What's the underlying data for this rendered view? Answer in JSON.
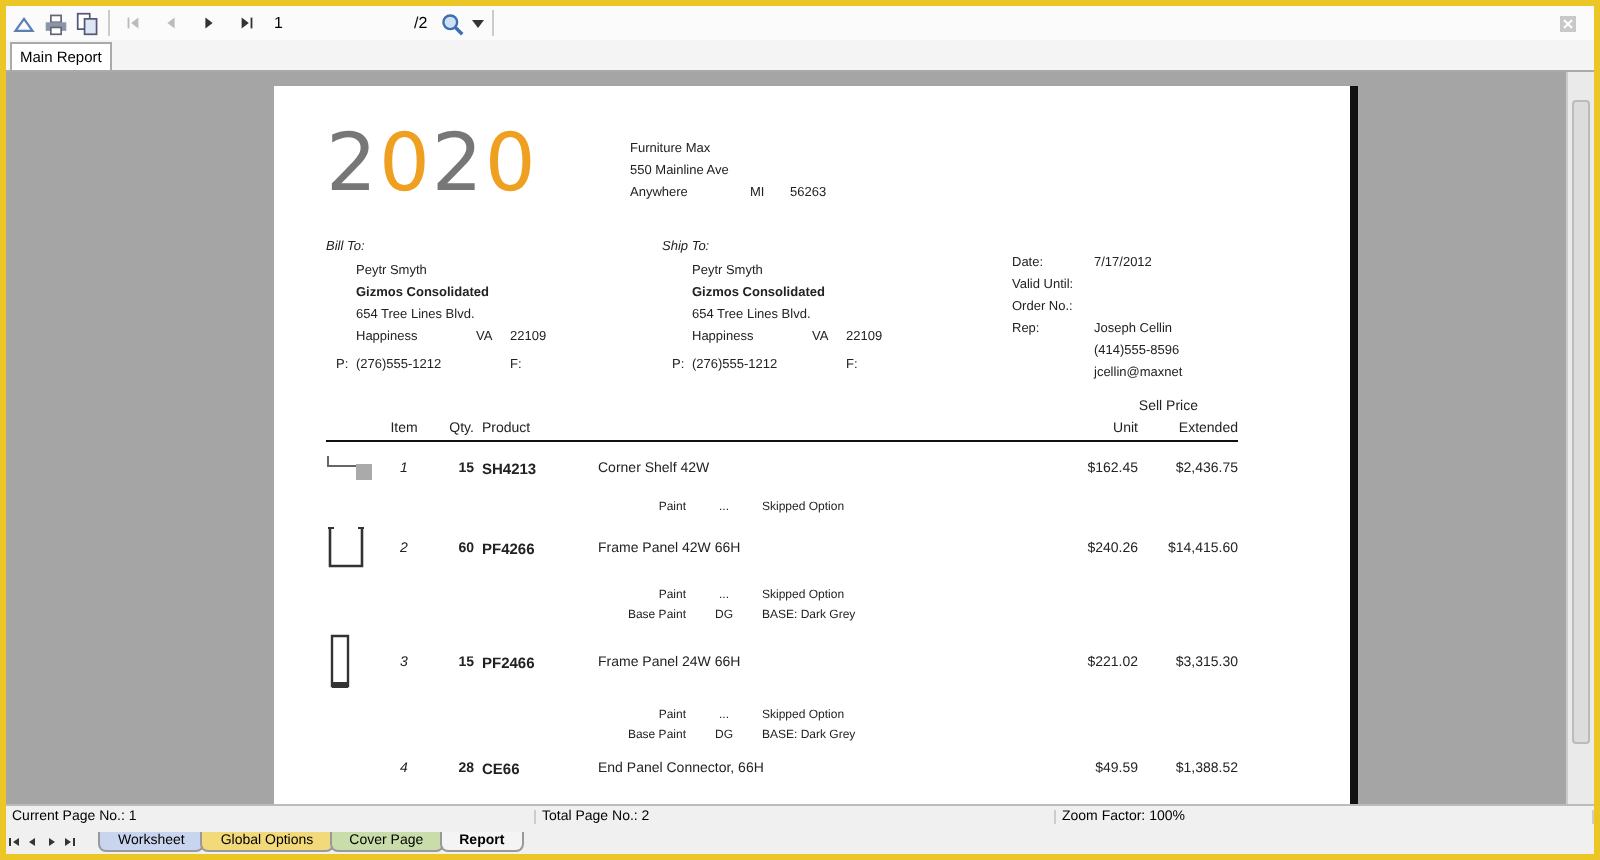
{
  "toolbar": {
    "page_input": "1",
    "page_total": "/2"
  },
  "tabs": [
    {
      "label": "Main Report",
      "selected": true
    }
  ],
  "report": {
    "logo": "2020",
    "company": {
      "name": "Furniture Max",
      "street": "550 Mainline Ave",
      "city": "Anywhere",
      "state": "MI",
      "zip": "56263"
    },
    "addresses": [
      {
        "heading": "Bill To:",
        "name": "Peytr Smyth",
        "company": "Gizmos Consolidated",
        "street": "654 Tree Lines Blvd.",
        "city": "Happiness",
        "state": "VA",
        "zip": "22109",
        "phone_label": "P:",
        "phone": "(276)555-1212",
        "fax_label": "F:"
      },
      {
        "heading": "Ship To:",
        "name": "Peytr Smyth",
        "company": "Gizmos Consolidated",
        "street": "654 Tree Lines Blvd.",
        "city": "Happiness",
        "state": "VA",
        "zip": "22109",
        "phone_label": "P:",
        "phone": "(276)555-1212",
        "fax_label": "F:"
      }
    ],
    "order_info": [
      {
        "label": "Date:",
        "value": "7/17/2012"
      },
      {
        "label": "Valid Until:"
      },
      {
        "label": "Order No.:"
      },
      {
        "label": "Rep:",
        "value": "Joseph Cellin"
      },
      {
        "value": "(414)555-8596"
      },
      {
        "value": "jcellin@maxnet"
      }
    ],
    "price_group": "Sell Price",
    "columns": [
      "Item",
      "Qty.",
      "Product",
      "Unit",
      "Extended"
    ],
    "rows": [
      {
        "kind": "shelf",
        "item": "1",
        "qty": "15",
        "code": "SH4213",
        "description": "Corner Shelf 42W",
        "unit": "$162.45",
        "extended": "$2,436.75",
        "options": [
          {
            "name": "Paint",
            "code": "...",
            "description": "Skipped Option"
          }
        ]
      },
      {
        "kind": "wide-panel",
        "item": "2",
        "qty": "60",
        "code": "PF4266",
        "description": "Frame Panel 42W 66H",
        "unit": "$240.26",
        "extended": "$14,415.60",
        "options": [
          {
            "name": "Paint",
            "code": "...",
            "description": "Skipped Option"
          },
          {
            "name": "Base Paint",
            "code": "DG",
            "description": "BASE: Dark Grey"
          }
        ]
      },
      {
        "kind": "narrow-panel",
        "item": "3",
        "qty": "15",
        "code": "PF2466",
        "description": "Frame Panel 24W 66H",
        "unit": "$221.02",
        "extended": "$3,315.30",
        "options": [
          {
            "name": "Paint",
            "code": "...",
            "description": "Skipped Option"
          },
          {
            "name": "Base Paint",
            "code": "DG",
            "description": "BASE: Dark Grey"
          }
        ]
      },
      {
        "kind": "plain",
        "item": "4",
        "qty": "28",
        "code": "CE66",
        "description": "End Panel Connector, 66H",
        "unit": "$49.59",
        "extended": "$1,388.52",
        "options": []
      }
    ]
  },
  "status_bar": [
    "Current Page No.: 1",
    "Total Page No.: 2",
    "Zoom Factor: 100%"
  ],
  "sheet_tabs": [
    {
      "label": "Worksheet",
      "color": "#c9d5ee",
      "selected": false
    },
    {
      "label": "Global Options",
      "color": "#f2d97a",
      "selected": false
    },
    {
      "label": "Cover Page",
      "color": "#c9ddaa",
      "selected": false
    },
    {
      "label": "Report",
      "color": "#f4f4f4",
      "selected": true
    }
  ]
}
